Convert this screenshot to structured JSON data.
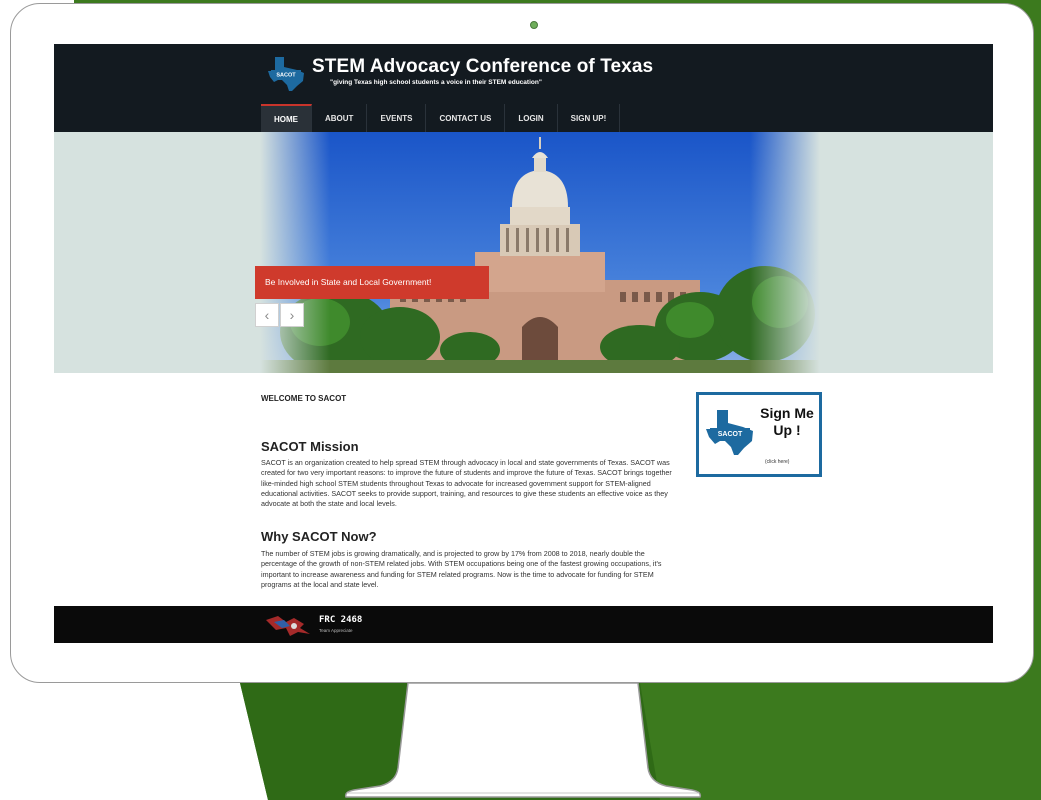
{
  "site": {
    "title": "STEM Advocacy Conference of Texas",
    "tagline": "\"giving Texas high school students a voice in their STEM education\"",
    "logo_text": "SACOT"
  },
  "nav": {
    "items": [
      {
        "label": "HOME",
        "active": true
      },
      {
        "label": "ABOUT"
      },
      {
        "label": "EVENTS"
      },
      {
        "label": "CONTACT US"
      },
      {
        "label": "LOGIN"
      },
      {
        "label": "SIGN UP!"
      }
    ]
  },
  "hero": {
    "caption": "Be Involved in State and Local Government!",
    "prev_icon": "chevron-left-icon",
    "next_icon": "chevron-right-icon"
  },
  "content": {
    "welcome": "WELCOME TO SACOT",
    "mission_heading": "SACOT Mission",
    "mission_text": "SACOT is an organization created to help spread STEM through advocacy in local and state governments of Texas. SACOT was created for two very important reasons: to improve the future of students and improve the future of Texas. SACOT brings together like-minded high school STEM students throughout Texas to advocate for increased government support for STEM-aligned educational activities. SACOT seeks to provide support, training, and resources to give these students an effective voice as they advocate at both the state and local levels.",
    "why_heading": "Why SACOT Now?",
    "why_text": "The number of STEM jobs is growing dramatically, and is projected to grow by 17% from 2008 to 2018, nearly double the percentage of the growth of non-STEM related jobs. With STEM occupations being one of the fastest growing occupations, it's important to increase awareness and funding for STEM related programs. Now is the time to advocate for funding for STEM programs at the local and state level."
  },
  "signup": {
    "line1": "Sign Me",
    "line2": "Up !",
    "small": "(click here)",
    "logo_text": "SACOT"
  },
  "footer": {
    "name": "FRC 2468",
    "sub": "Team Appreciate"
  },
  "colors": {
    "slide_green": "#3c7a1e",
    "header_bg": "#131a20",
    "accent_red": "#cf3a2c",
    "signup_border": "#1d6aa0",
    "texas_blue": "#1d6aa0"
  }
}
